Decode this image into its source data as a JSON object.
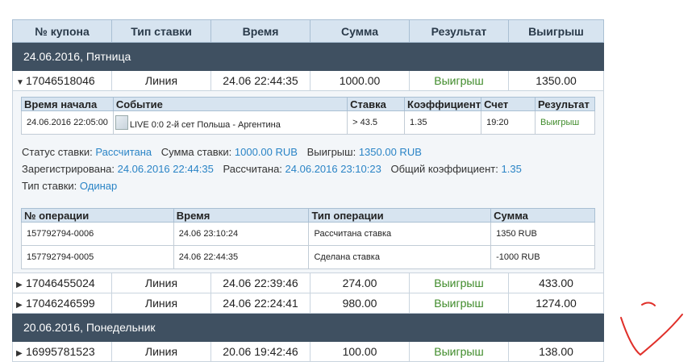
{
  "headers": [
    "№ купона",
    "Тип ставки",
    "Время",
    "Сумма",
    "Результат",
    "Выигрыш"
  ],
  "groups": [
    {
      "date": "24.06.2016, Пятница"
    },
    {
      "date": "20.06.2016, Понедельник"
    }
  ],
  "coupons": [
    {
      "id": "17046518046",
      "type": "Линия",
      "time": "24.06 22:44:35",
      "amount": "1000.00",
      "result": "Выигрыш",
      "payout": "1350.00",
      "expanded": true
    },
    {
      "id": "17046455024",
      "type": "Линия",
      "time": "24.06 22:39:46",
      "amount": "274.00",
      "result": "Выигрыш",
      "payout": "433.00"
    },
    {
      "id": "17046246599",
      "type": "Линия",
      "time": "24.06 22:24:41",
      "amount": "980.00",
      "result": "Выигрыш",
      "payout": "1274.00"
    },
    {
      "id": "16995781523",
      "type": "Линия",
      "time": "20.06 19:42:46",
      "amount": "100.00",
      "result": "Выигрыш",
      "payout": "138.00"
    }
  ],
  "detail": {
    "event_headers": [
      "Время начала",
      "Событие",
      "Ставка",
      "Коэффициент",
      "Счет",
      "Результат"
    ],
    "event": {
      "start": "24.06.2016 22:05:00",
      "name": "LIVE 0:0 2-й сет Польша - Аргентина",
      "bet": "> 43.5",
      "coef": "1.35",
      "score": "19:20",
      "result": "Выигрыш"
    },
    "status_label": "Статус ставки:",
    "status_value": "Рассчитана",
    "sum_label": "Сумма ставки:",
    "sum_value": "1000.00 RUB",
    "win_label": "Выигрыш:",
    "win_value": "1350.00 RUB",
    "reg_label": "Зарегистрирована:",
    "reg_value": "24.06.2016 22:44:35",
    "calc_label": "Рассчитана:",
    "calc_value": "24.06.2016 23:10:23",
    "total_coef_label": "Общий коэффициент:",
    "total_coef_value": "1.35",
    "bet_type_label": "Тип ставки:",
    "bet_type_value": "Одинар",
    "op_headers": [
      "№ операции",
      "Время",
      "Тип операции",
      "Сумма"
    ],
    "operations": [
      {
        "id": "157792794-0006",
        "time": "24.06 23:10:24",
        "type": "Рассчитана ставка",
        "sum": "1350 RUB"
      },
      {
        "id": "157792794-0005",
        "time": "24.06 22:44:35",
        "type": "Сделана ставка",
        "sum": "-1000 RUB"
      }
    ]
  },
  "colors": {
    "header_bg": "#d7e4f0",
    "date_bg": "#3f5061",
    "win": "#3f8b2a",
    "link": "#2a84c6",
    "mark": "#e0302a"
  }
}
